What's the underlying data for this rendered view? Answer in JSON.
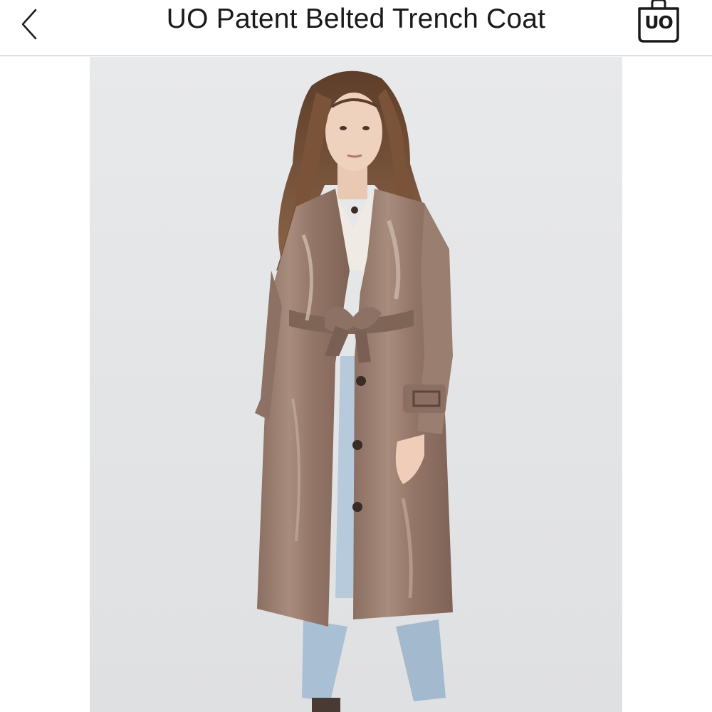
{
  "nav": {
    "back_icon": "chevron-left-icon",
    "title": "UO Patent Belted Trench Coat",
    "cart_icon": "shopping-bag-icon",
    "cart_label": "UO"
  },
  "product_image": {
    "alt": "UO Patent Belted Trench Coat",
    "background_color": "#e6e7e9",
    "coat_color": "#9a7e70",
    "jeans_color": "#a9bfd3",
    "hair_color": "#6e4a33"
  }
}
